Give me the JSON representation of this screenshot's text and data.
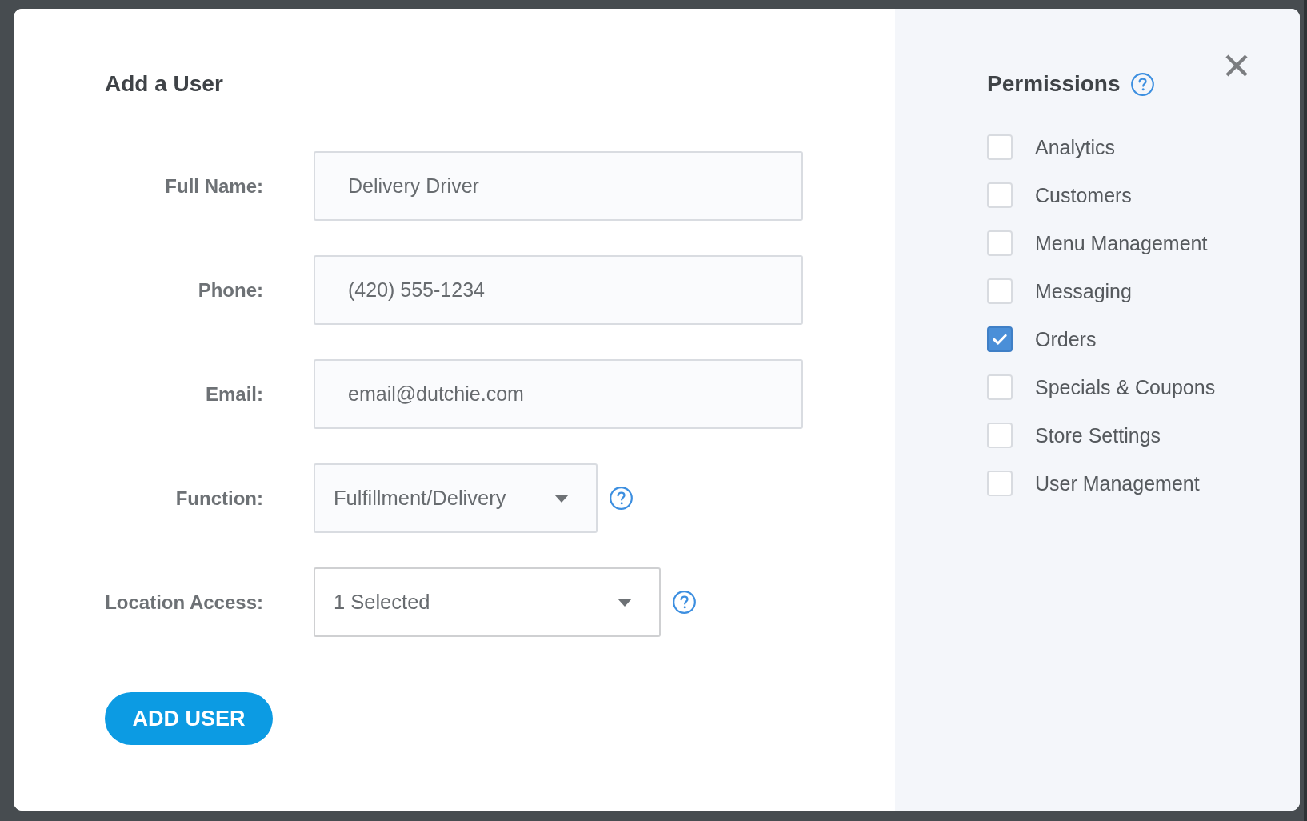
{
  "form": {
    "title": "Add a User",
    "fields": [
      {
        "label": "Full Name:",
        "kind": "text",
        "value": "Delivery Driver",
        "help": false
      },
      {
        "label": "Phone:",
        "kind": "text",
        "value": "(420) 555-1234",
        "help": false
      },
      {
        "label": "Email:",
        "kind": "text",
        "value": "email@dutchie.com",
        "help": false
      },
      {
        "label": "Function:",
        "kind": "select",
        "value": "Fulfillment/Delivery",
        "help": true
      },
      {
        "label": "Location Access:",
        "kind": "multiselect",
        "value": "1 Selected",
        "help": true
      }
    ],
    "submit": "ADD USER"
  },
  "permissions": {
    "title": "Permissions",
    "help": true,
    "items": [
      {
        "label": "Analytics",
        "checked": false
      },
      {
        "label": "Customers",
        "checked": false
      },
      {
        "label": "Menu Management",
        "checked": false
      },
      {
        "label": "Messaging",
        "checked": false
      },
      {
        "label": "Orders",
        "checked": true
      },
      {
        "label": "Specials & Coupons",
        "checked": false
      },
      {
        "label": "Store Settings",
        "checked": false
      },
      {
        "label": "User Management",
        "checked": false
      }
    ]
  }
}
